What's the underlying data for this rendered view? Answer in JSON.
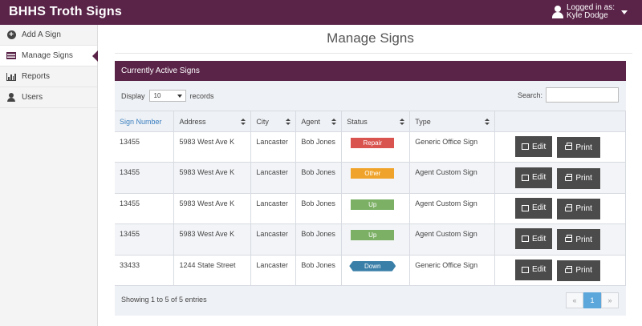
{
  "app": {
    "title": "BHHS Troth Signs"
  },
  "user": {
    "logged_in_label": "Logged in as:",
    "name": "Kyle Dodge"
  },
  "sidebar": {
    "items": [
      {
        "label": "Add A Sign",
        "icon": "plus-circle-icon"
      },
      {
        "label": "Manage Signs",
        "icon": "flag-icon",
        "active": true
      },
      {
        "label": "Reports",
        "icon": "bar-chart-icon"
      },
      {
        "label": "Users",
        "icon": "user-icon"
      }
    ]
  },
  "main": {
    "title": "Manage Signs"
  },
  "panel": {
    "title": "Currently Active Signs",
    "display_label": "Display",
    "display_value": "10",
    "records_label": "records",
    "search_label": "Search:",
    "search_value": "",
    "columns": [
      "Sign Number",
      "Address",
      "City",
      "Agent",
      "Status",
      "Type"
    ],
    "rows": [
      {
        "sign_number": "13455",
        "address": "5983 West Ave K",
        "city": "Lancaster",
        "agent": "Bob Jones",
        "status": "Repair",
        "type": "Generic Office Sign",
        "edit": "Edit",
        "print": "Print"
      },
      {
        "sign_number": "13455",
        "address": "5983 West Ave K",
        "city": "Lancaster",
        "agent": "Bob Jones",
        "status": "Other",
        "type": "Agent Custom Sign",
        "edit": "Edit",
        "print": "Print"
      },
      {
        "sign_number": "13455",
        "address": "5983 West Ave K",
        "city": "Lancaster",
        "agent": "Bob Jones",
        "status": "Up",
        "type": "Agent Custom Sign",
        "edit": "Edit",
        "print": "Print"
      },
      {
        "sign_number": "13455",
        "address": "5983 West Ave K",
        "city": "Lancaster",
        "agent": "Bob Jones",
        "status": "Up",
        "type": "Agent Custom Sign",
        "edit": "Edit",
        "print": "Print"
      },
      {
        "sign_number": "33433",
        "address": "1244 State Street",
        "city": "Lancaster",
        "agent": "Bob Jones",
        "status": "Down",
        "type": "Generic Office Sign",
        "edit": "Edit",
        "print": "Print"
      }
    ],
    "info": "Showing 1 to 5 of 5 entries",
    "pager": {
      "prev": "«",
      "current": "1",
      "next": "»"
    }
  },
  "colors": {
    "brand": "#5a2449",
    "status_repair": "#d9534f",
    "status_other": "#f0a32a",
    "status_up": "#7cb065",
    "status_down": "#3a7fa8",
    "pager_active": "#5ba7dc"
  }
}
